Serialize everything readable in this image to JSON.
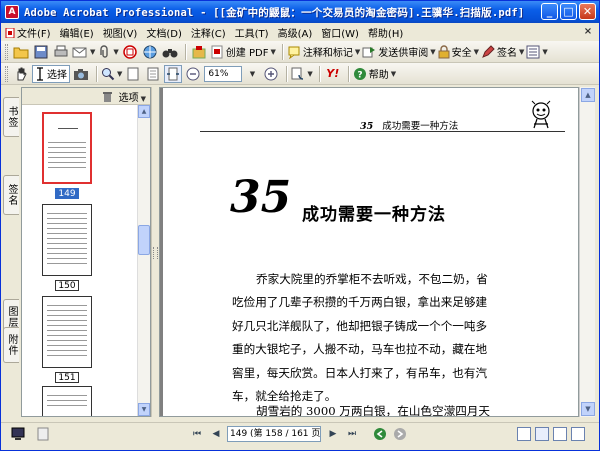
{
  "window": {
    "title": "Adobe Acrobat Professional - [[金矿中的鼹鼠：一个交易员的淘金密码].王骥华.扫描版.pdf]",
    "app_icon": "A",
    "minimize": "_",
    "maximize": "□",
    "close": "✕"
  },
  "menu": {
    "items": [
      "文件(F)",
      "编辑(E)",
      "视图(V)",
      "文档(D)",
      "注释(C)",
      "工具(T)",
      "高级(A)",
      "窗口(W)",
      "帮助(H)"
    ],
    "close_doc": "×"
  },
  "toolbar1": {
    "create_pdf": "创建 PDF",
    "review_comment": "注释和标记",
    "send_review": "发送供审阅",
    "secure": "安全",
    "sign": "签名"
  },
  "toolbar2": {
    "select": "选择",
    "zoom_value": "61%",
    "help": "帮助",
    "yahoo": "Y!"
  },
  "sidetabs": {
    "bookmarks": "书签",
    "signatures": "签名",
    "layers": "图层",
    "attachments": "附件"
  },
  "thumbnails": {
    "options_label": "选项",
    "pages": [
      {
        "label": "149",
        "selected": true
      },
      {
        "label": "150",
        "selected": false
      },
      {
        "label": "151",
        "selected": false
      }
    ]
  },
  "document": {
    "running_head_num": "35",
    "running_head_title": "成功需要一种方法",
    "chapter_number": "35",
    "chapter_title": "成功需要一种方法",
    "paragraph1": [
      "乔家大院里的乔掌柜不去听戏，不包二奶，省",
      "吃俭用了几辈子积攒的千万两白银，拿出来足够建",
      "好几只北洋舰队了，他却把银子铸成一个个一吨多",
      "重的大银坨子，人搬不动，马车也拉不动，藏在地",
      "窖里，每天欣赏。日本人打来了，有吊车，也有汽",
      "车，就全给抢走了。"
    ],
    "paragraph2": [
      "胡雪岩的 3000 万两白银，在山色空濛四月天"
    ]
  },
  "statusbar": {
    "page_display": "149 (第 158 / 161 页)",
    "first": "⏮",
    "prev": "◀",
    "next": "▶",
    "last": "⏭"
  },
  "colors": {
    "titlebar": "#0a5ee8",
    "chrome": "#ece9d8",
    "selection": "#316ac5",
    "thumb_highlight": "#e03030"
  }
}
